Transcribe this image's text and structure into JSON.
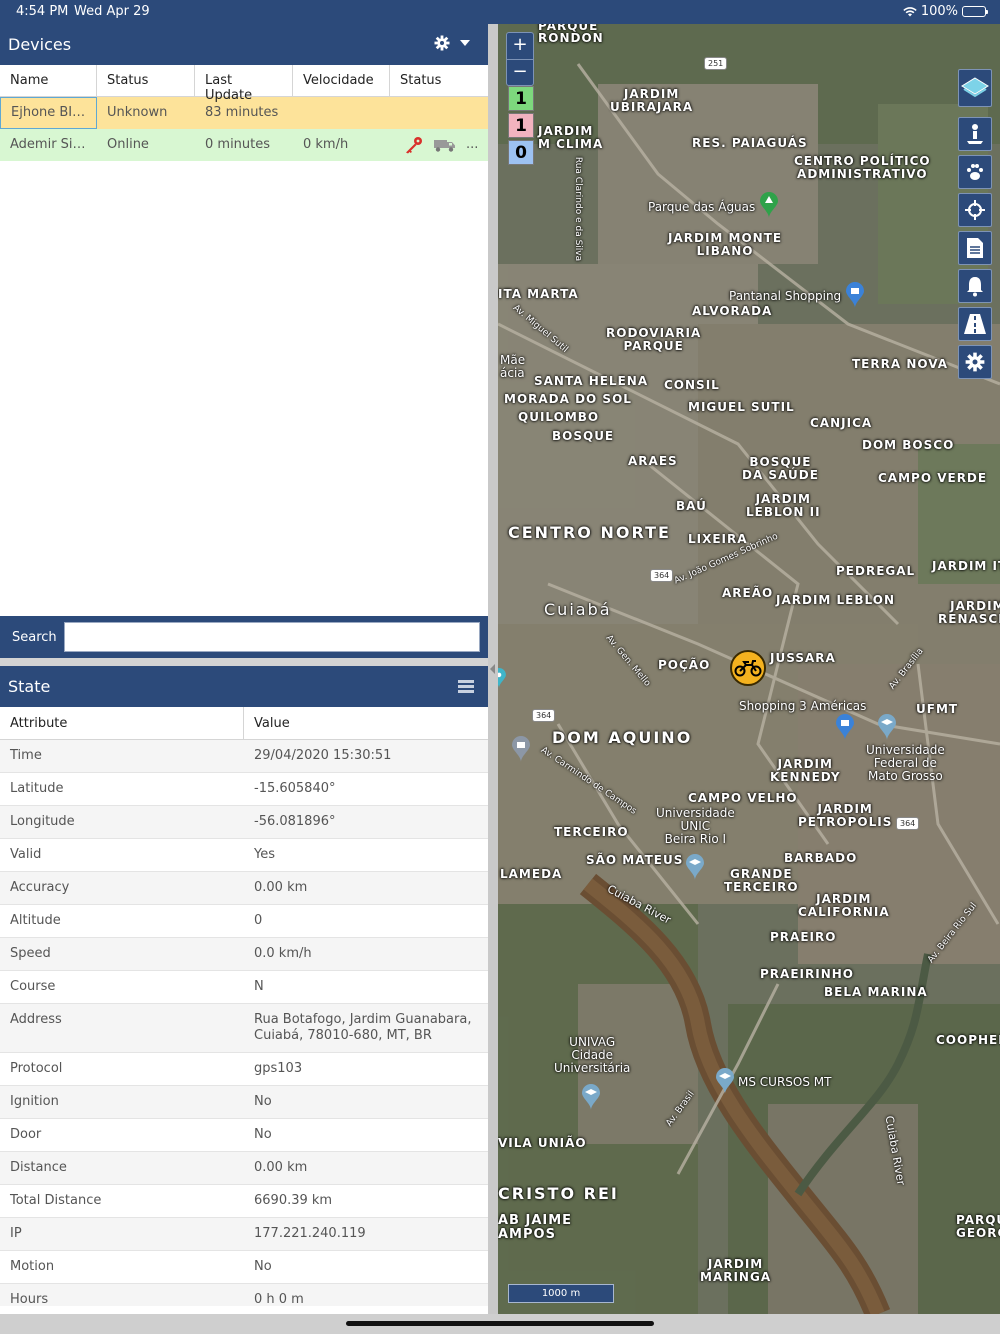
{
  "status_bar": {
    "time": "4:54 PM",
    "date": "Wed Apr 29",
    "battery": "100%"
  },
  "devices_panel": {
    "title": "Devices",
    "columns": [
      "Name",
      "Status",
      "Last Update",
      "Velocidade",
      "Status"
    ],
    "rows": [
      {
        "name": "Ejhone BIZ1...",
        "status": "Unknown",
        "last_update": "83 minutes",
        "speed": "",
        "state": "unknown"
      },
      {
        "name": "Ademir Silv...",
        "status": "Online",
        "last_update": "0 minutes",
        "speed": "0 km/h",
        "state": "online",
        "more": "..."
      }
    ],
    "search_label": "Search",
    "search_value": ""
  },
  "state_panel": {
    "title": "State",
    "columns": [
      "Attribute",
      "Value"
    ],
    "rows": [
      {
        "attribute": "Time",
        "value": "29/04/2020 15:30:51"
      },
      {
        "attribute": "Latitude",
        "value": "-15.605840°"
      },
      {
        "attribute": "Longitude",
        "value": "-56.081896°"
      },
      {
        "attribute": "Valid",
        "value": "Yes"
      },
      {
        "attribute": "Accuracy",
        "value": "0.00 km"
      },
      {
        "attribute": "Altitude",
        "value": "0"
      },
      {
        "attribute": "Speed",
        "value": "0.0 km/h"
      },
      {
        "attribute": "Course",
        "value": "N"
      },
      {
        "attribute": "Address",
        "value": "Rua Botafogo, Jardim Guanabara, Cuiabá, 78010-680, MT, BR"
      },
      {
        "attribute": "Protocol",
        "value": "gps103"
      },
      {
        "attribute": "Ignition",
        "value": "No"
      },
      {
        "attribute": "Door",
        "value": "No"
      },
      {
        "attribute": "Distance",
        "value": "0.00 km"
      },
      {
        "attribute": "Total Distance",
        "value": "6690.39 km"
      },
      {
        "attribute": "IP",
        "value": "177.221.240.119"
      },
      {
        "attribute": "Motion",
        "value": "No"
      },
      {
        "attribute": "Hours",
        "value": "0 h 0 m"
      }
    ]
  },
  "map": {
    "zoom_in": "+",
    "zoom_out": "−",
    "clusters": [
      "1",
      "1",
      "0"
    ],
    "scale": "1000 m",
    "labels": {
      "parque_rondon": "PARQUE\nRONDON",
      "jardim_ubirajara": "JARDIM\nUBIRAJARA",
      "jardim_clima": "JARDIM\nM CLIMA",
      "res_paiaguas": "RES. PAIAGUÁS",
      "centro_politico": "CENTRO POLÍTICO\nADMINISTRATIVO",
      "parque_aguas": "Parque das Águas",
      "jardim_monte_libano": "JARDIM MONTE\nLIBANO",
      "pantanal_shopping": "Pantanal Shopping",
      "alvorada": "ALVORADA",
      "santa_marta": "ITA MARTA",
      "rodoviaria": "RODOVIARIA\nPARQUE",
      "terra_nova": "TERRA NOVA",
      "mae_bonifacia": "Mãe\nácia",
      "santa_helena": "SANTA HELENA",
      "consil": "CONSIL",
      "morada_do_sol": "MORADA DO SOL",
      "quilombo": "QUILOMBO",
      "miguel_sutil": "MIGUEL SUTIL",
      "canjica": "CANJICA",
      "bosque": "BOSQUE",
      "dom_bosco": "DOM BOSCO",
      "araes": "ARAES",
      "bosque_saude": "BOSQUE\nDA SAÚDE",
      "campo_verde": "CAMPO VERDE",
      "bau": "BAÚ",
      "jardim_leblon_ii": "JARDIM\nLEBLON II",
      "centro_norte": "CENTRO NORTE",
      "lixeira": "LIXEIRA",
      "pedregal": "PEDREGAL",
      "jardim_it": "JARDIM IT",
      "areao": "AREÃO",
      "jardim_leblon": "JARDIM LEBLON",
      "cuiaba": "Cuiabá",
      "jardim_renascer": "JARDIM\nRENASCER",
      "pocao": "POÇÃO",
      "jussara": "JUSSARA",
      "shopping_3_americas": "Shopping 3 Américas",
      "ufmt": "UFMT",
      "dom_aquino": "DOM AQUINO",
      "universidade_federal": "Universidade\nFederal de\nMato Grosso",
      "jardim_kennedy": "JARDIM\nKENNEDY",
      "campo_velho": "CAMPO VELHO",
      "unic": "Universidade\nUNIC\nBeira Rio I",
      "jardim_petropolis": "JARDIM\nPETROPOLIS",
      "terceiro": "TERCEIRO",
      "sao_mateus": "SÃO MATEUS",
      "barbado": "BARBADO",
      "lameda": "LAMEDA",
      "grande_terceiro": "GRANDE\nTERCEIRO",
      "jardim_california": "JARDIM\nCALIFORNIA",
      "praeiro": "PRAEIRO",
      "cuiaba_river": "Cuiaba River",
      "praeirinho": "PRAEIRINHO",
      "bela_marina": "BELA MARINA",
      "univag": "UNIVAG\nCidade\nUniversitária",
      "coophem": "COOPHEM",
      "ms_cursos": "MS CURSOS MT",
      "vila_uniao": "VILA UNIÃO",
      "cristo_rei": "CRISTO REI",
      "cuiaba_river_2": "Cuiaba River",
      "jaime": "AB JAIME\nAMPOS",
      "parque_georg": "PARQU\nGEORG",
      "jardim_maringa": "JARDIM\nMARINGA",
      "av_miguel_sutil": "Av. Miguel Sutil",
      "av_joao_gomes": "Av. João Gomes Sobrinho",
      "av_gen_mello": "Av. Gen. Mello",
      "av_carmindo": "Av. Carmindo de Campos",
      "av_brasil": "Av. Brasil",
      "av_beira_rio": "Av. Beira Rio Sul",
      "av_brasilia": "Av. Brasília",
      "rua_clarindo": "Rua Clarindo e da Silva",
      "sh_251": "251",
      "sh_364a": "364",
      "sh_364b": "364",
      "sh_364c": "364"
    }
  },
  "colors": {
    "header": "#2c4a7a",
    "unknown_row": "#fde39a",
    "online_row": "#d8f7d2",
    "marker": "#f4b21f"
  }
}
